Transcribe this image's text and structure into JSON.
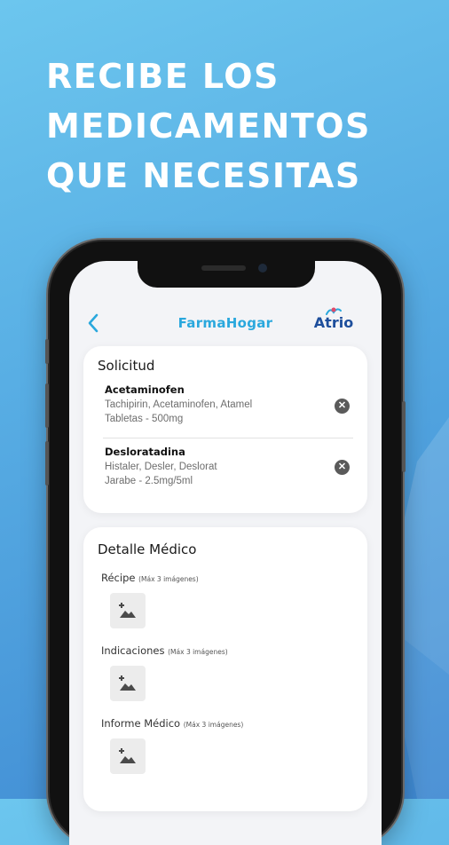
{
  "headline": [
    "RECIBE LOS",
    "MEDICAMENTOS",
    "QUE NECESITAS"
  ],
  "app": {
    "title": "FarmaHogar",
    "logo_text": "Atrio"
  },
  "solicitud": {
    "title": "Solicitud",
    "items": [
      {
        "name": "Acetaminofen",
        "brands": "Tachipirin, Acetaminofen, Atamel",
        "presentation": "Tabletas - 500mg"
      },
      {
        "name": "Desloratadina",
        "brands": "Histaler, Desler, Deslorat",
        "presentation": "Jarabe - 2.5mg/5ml"
      }
    ]
  },
  "detalle": {
    "title": "Detalle Médico",
    "fields": [
      {
        "label": "Récipe",
        "hint": "(Máx 3 imágenes)"
      },
      {
        "label": "Indicaciones",
        "hint": "(Máx 3 imágenes)"
      },
      {
        "label": "Informe Médico",
        "hint": "(Máx 3 imágenes)"
      }
    ]
  },
  "colors": {
    "accent": "#2aa8dd",
    "logo": "#1d4e9c"
  },
  "icons": [
    "back-chevron-icon",
    "close-circle-icon",
    "add-image-icon"
  ]
}
